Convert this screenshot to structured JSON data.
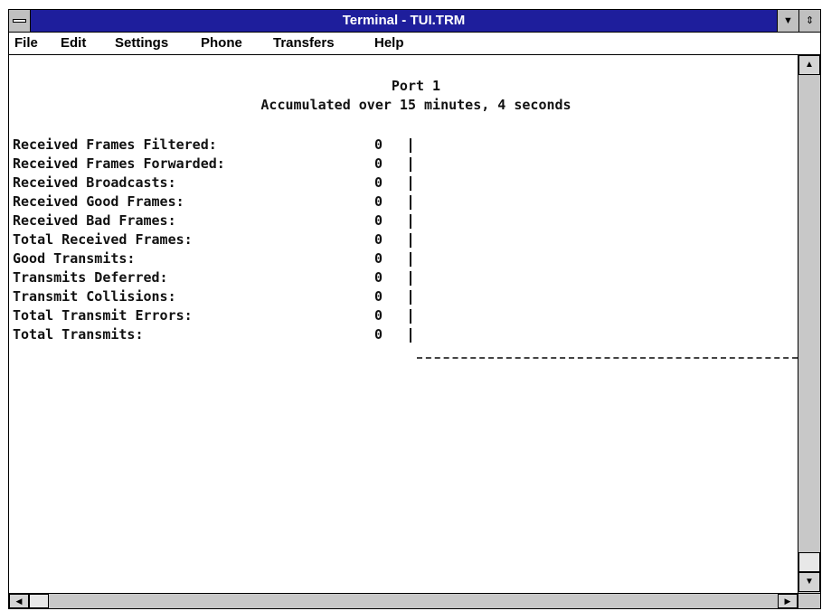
{
  "window": {
    "title": "Terminal - TUI.TRM"
  },
  "menu": [
    {
      "label": "File"
    },
    {
      "label": "Edit"
    },
    {
      "label": "Settings"
    },
    {
      "label": "Phone"
    },
    {
      "label": "Transfers"
    },
    {
      "label": "Help"
    }
  ],
  "terminal": {
    "heading": "Port 1",
    "subheading": "Accumulated over 15 minutes, 4 seconds",
    "stats": [
      {
        "label": "Received Frames Filtered:",
        "value": "0"
      },
      {
        "label": "Received Frames Forwarded:",
        "value": "0"
      },
      {
        "label": "Received Broadcasts:",
        "value": "0"
      },
      {
        "label": "Received Good Frames:",
        "value": "0"
      },
      {
        "label": "Received Bad Frames:",
        "value": "0"
      },
      {
        "label": "Total Received Frames:",
        "value": "0"
      },
      {
        "label": "Good Transmits:",
        "value": "0"
      },
      {
        "label": "Transmits Deferred:",
        "value": "0"
      },
      {
        "label": "Transmit Collisions:",
        "value": "0"
      },
      {
        "label": "Total Transmit Errors:",
        "value": "0"
      },
      {
        "label": "Total Transmits:",
        "value": "0"
      }
    ]
  },
  "icons": {
    "system_menu": "system-menu-icon",
    "minimize": "down-triangle-icon",
    "maximize": "up-down-triangle-icon",
    "scroll_up": "up-arrow-icon",
    "scroll_down": "down-arrow-icon",
    "scroll_left": "left-arrow-icon",
    "scroll_right": "right-arrow-icon"
  },
  "colors": {
    "titlebar": "#1e1e9c",
    "title_text": "#ffffff",
    "chrome": "#c0c0c0"
  }
}
